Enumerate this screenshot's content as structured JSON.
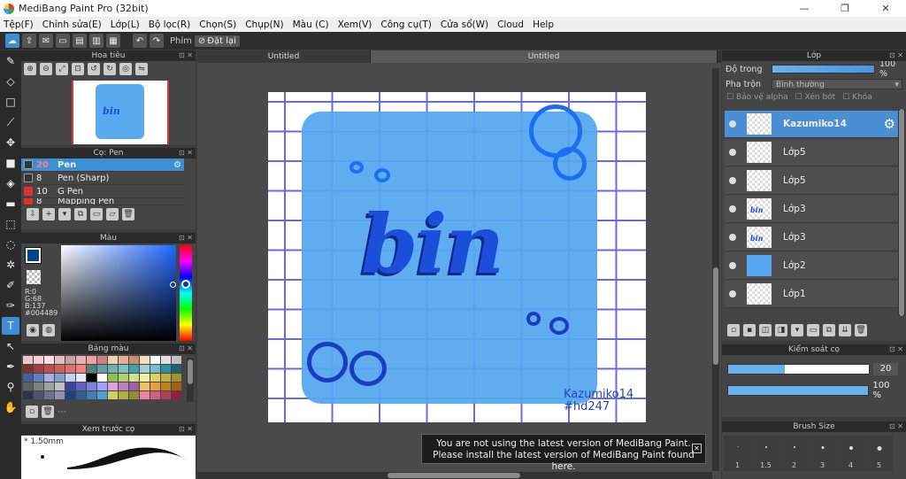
{
  "window": {
    "title": "MediBang Paint Pro (32bit)",
    "min": "—",
    "max": "❐",
    "close": "✕"
  },
  "menu": [
    "Tệp(F)",
    "Chỉnh sửa(E)",
    "Lớp(L)",
    "Bộ lọc(R)",
    "Chọn(S)",
    "Chụp(N)",
    "Màu (C)",
    "Xem(V)",
    "Công cụ(T)",
    "Cửa sổ(W)",
    "Cloud",
    "Help"
  ],
  "toolbar": {
    "finger_label": "Phím",
    "reset_label": "Đặt lại"
  },
  "navigator": {
    "title": "Hoa tiêu",
    "thumb_text": "bin"
  },
  "brush_panel": {
    "title": "Cọ: Pen",
    "items": [
      {
        "size": "20",
        "name": "Pen",
        "color": "#333333"
      },
      {
        "size": "8",
        "name": "Pen (Sharp)",
        "color": "#333333"
      },
      {
        "size": "10",
        "name": "G Pen",
        "color": "#e03030"
      },
      {
        "size": "8",
        "name": "Mapping Pen",
        "color": "#e03030"
      }
    ]
  },
  "color_panel": {
    "title": "Màu",
    "r": "R:0",
    "g": "G:68",
    "b": "B:137",
    "hex": "#004489"
  },
  "palette_panel": {
    "title": "Bảng màu",
    "colors": [
      "#e8c8c8",
      "#f0d0d0",
      "#f8e0e0",
      "#e0c0c0",
      "#c8a0a0",
      "#e8b0b0",
      "#f0a0a0",
      "#d08080",
      "#f0d0b0",
      "#e0b090",
      "#c89070",
      "#f0e0c0",
      "#ffffff",
      "#e0e0e0",
      "#c0c0c0",
      "#803030",
      "#a04040",
      "#c05050",
      "#d06060",
      "#e07070",
      "#f08080",
      "#508080",
      "#60a0a0",
      "#70b0b0",
      "#80c0c0",
      "#40a0b0",
      "#a0d0d0",
      "#70c0d0",
      "#3090a0",
      "#206070",
      "#4060a0",
      "#6080c0",
      "#a0b0e0",
      "#80a0d0",
      "#c0d0f0",
      "#e0e8ff",
      "#000000",
      "#ffffff",
      "#90c050",
      "#b0d070",
      "#d0e090",
      "#f0f0a0",
      "#e0d060",
      "#c0b040",
      "#a09030",
      "#606060",
      "#808080",
      "#a0a0a0",
      "#c0c0c0",
      "#4040a0",
      "#6060c0",
      "#8080e0",
      "#a0a0ff",
      "#e0a0e0",
      "#c080c0",
      "#a060a0",
      "#f0c060",
      "#e0a040",
      "#c08020",
      "#a06010",
      "#303050",
      "#505070",
      "#707090",
      "#9090b0",
      "#204080",
      "#306090",
      "#4080b0",
      "#50a0d0",
      "#d0d060",
      "#b0b040",
      "#909030",
      "#f080a0",
      "#d06080",
      "#b04060",
      "#902040"
    ]
  },
  "brush_preview": {
    "title": "Xem trước cọ",
    "size": "1.50mm"
  },
  "canvas": {
    "tabs": [
      "Untitled",
      "Untitled"
    ],
    "art_text": "bin",
    "signature_1": "Kazumiko14",
    "signature_2": "#hd247"
  },
  "notice": {
    "line1": "You are not using the latest version of MediBang Paint.",
    "line2": "Please install the latest version of MediBang Paint found here."
  },
  "layers": {
    "title": "Lớp",
    "opacity_label": "Độ trong",
    "opacity_value": "100 %",
    "opacity_fraction": 1.0,
    "blend_label": "Pha trộn",
    "blend_value": "Bình thường",
    "protect_alpha": "Bảo vệ alpha",
    "clipping": "Xén bớt",
    "lock": "Khóa",
    "items": [
      {
        "name": "Kazumiko14",
        "thumb": "sig"
      },
      {
        "name": "Lớp5",
        "thumb": "dots"
      },
      {
        "name": "Lớp5",
        "thumb": "dots"
      },
      {
        "name": "Lớp3",
        "thumb": "text",
        "thumb_text": "bin"
      },
      {
        "name": "Lớp3",
        "thumb": "text",
        "thumb_text": "bin"
      },
      {
        "name": "Lớp2",
        "thumb": "blue"
      },
      {
        "name": "Lớp1",
        "thumb": "empty"
      }
    ]
  },
  "brush_control": {
    "title": "Kiểm soát cọ",
    "size_value": "20",
    "size_fraction": 0.4,
    "opacity_value": "100 %",
    "opacity_fraction": 1.0
  },
  "brush_size": {
    "title": "Brush Size",
    "sizes": [
      "1",
      "1.5",
      "2",
      "3",
      "4",
      "5"
    ]
  },
  "colors": {
    "accent": "#3d8fd4",
    "canvas_blue": "#56a8f0",
    "text_blue": "#1c4fd9"
  }
}
